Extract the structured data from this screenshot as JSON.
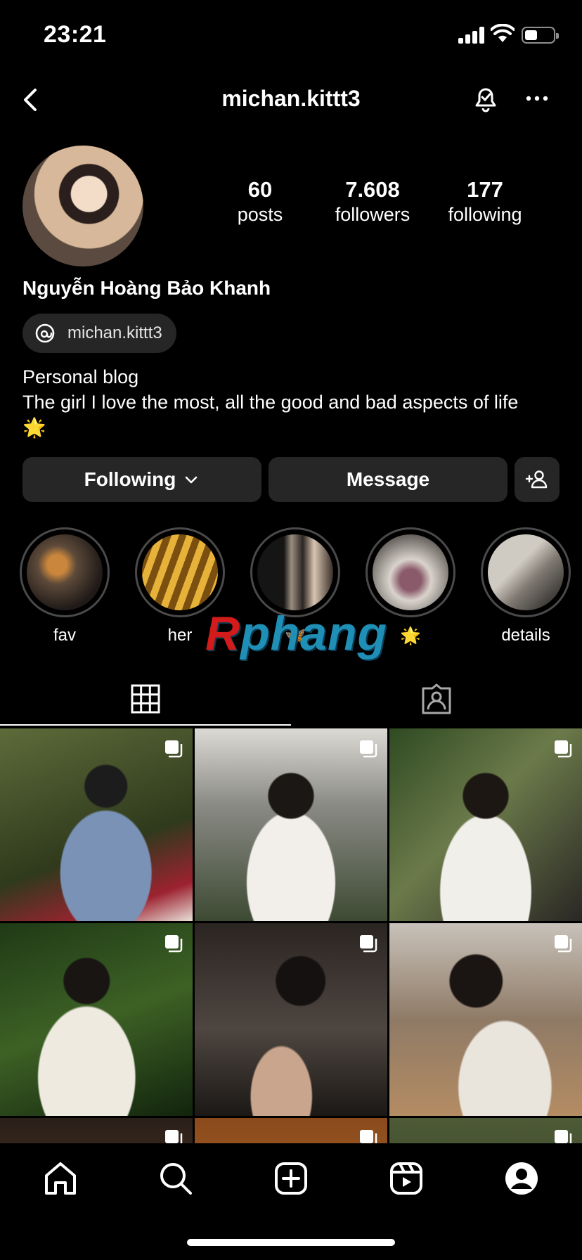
{
  "status_bar": {
    "time": "23:21",
    "battery_level": 0.45
  },
  "header": {
    "username": "michan.kittt3",
    "icons": [
      "back-chevron-icon",
      "notification-bell-icon",
      "more-options-icon"
    ]
  },
  "profile": {
    "stats": [
      {
        "value": "60",
        "label": "posts"
      },
      {
        "value": "7.608",
        "label": "followers"
      },
      {
        "value": "177",
        "label": "following"
      }
    ],
    "display_name": "Nguyễn Hoàng Bảo Khanh",
    "threads_handle": "michan.kittt3",
    "bio_line1": "Personal blog",
    "bio_line2": "The girl I love the most, all the good and bad aspects of life",
    "bio_emoji": "🌟"
  },
  "buttons": {
    "following": "Following",
    "message": "Message"
  },
  "highlights": [
    {
      "label": "fav"
    },
    {
      "label": "her"
    },
    {
      "label": "🦋"
    },
    {
      "label": "🌟"
    },
    {
      "label": "details"
    }
  ],
  "watermark": {
    "first": "R",
    "rest": "phang"
  },
  "tabs": [
    "posts-grid-icon",
    "tagged-icon"
  ],
  "bottom_nav": [
    "home-icon",
    "search-icon",
    "create-icon",
    "reels-icon",
    "profile-icon"
  ],
  "colors": {
    "background": "#000000",
    "surface": "#262626",
    "text": "#ffffff"
  }
}
